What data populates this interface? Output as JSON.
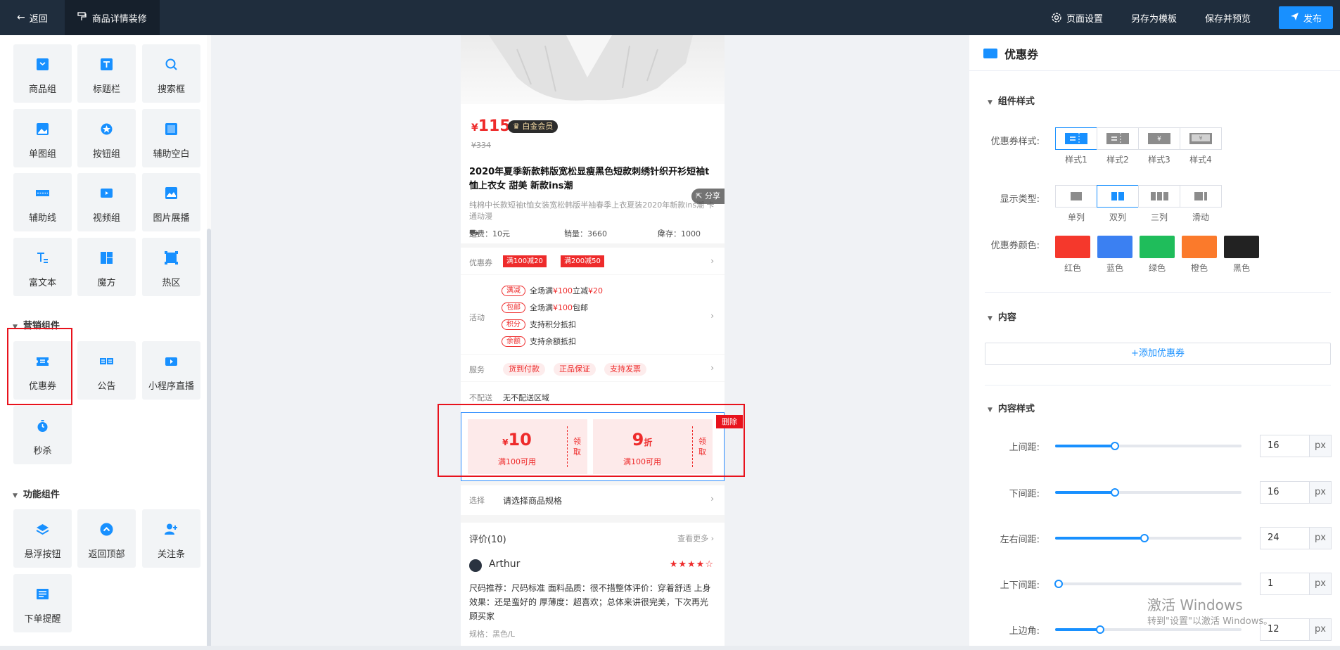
{
  "topbar": {
    "back_label": "返回",
    "active_tab": "商品详情装修",
    "page_settings": "页面设置",
    "save_template": "另存为模板",
    "save_preview": "保存并预览",
    "publish": "发布"
  },
  "left": {
    "basic_components": [
      "商品组",
      "标题栏",
      "搜索框",
      "单图组",
      "按钮组",
      "辅助空白",
      "辅助线",
      "视频组",
      "图片展播",
      "富文本",
      "魔方",
      "热区"
    ],
    "marketing_title": "营销组件",
    "marketing_components": [
      "优惠券",
      "公告",
      "小程序直播",
      "秒杀"
    ],
    "function_title": "功能组件",
    "function_components": [
      "悬浮按钮",
      "返回顶部",
      "关注条",
      "下单提醒"
    ]
  },
  "phone": {
    "price_symbol": "¥",
    "price": "115",
    "vip_badge": "白金会员",
    "old_price": "¥334",
    "title": "2020年夏季新款韩版宽松显瘦黑色短款刺绣针织开衫短袖t恤上衣女 甜美 新款ins潮",
    "desc": "纯棉中长款短袖t恤女装宽松韩版半袖春季上衣夏装2020年新款ins潮 卡通动漫",
    "share": "分享",
    "freight": "运费：10元",
    "sales": "销量：3660",
    "stock": "库存：1000",
    "coupon_label": "优惠券",
    "coupon_tags": [
      "满100减20",
      "满200减50"
    ],
    "activity_label": "活动",
    "activities": [
      {
        "badge": "满减",
        "pre": "全场满 ",
        "red1": "¥100",
        "mid": " 立减 ",
        "red2": "¥20",
        "post": ""
      },
      {
        "badge": "包邮",
        "pre": "全场满 ",
        "red1": "¥100",
        "mid": "包邮",
        "red2": "",
        "post": ""
      },
      {
        "badge": "积分",
        "pre": "支持积分抵扣",
        "red1": "",
        "mid": "",
        "red2": "",
        "post": ""
      },
      {
        "badge": "余额",
        "pre": "支持余额抵扣",
        "red1": "",
        "mid": "",
        "red2": "",
        "post": ""
      }
    ],
    "service_label": "服务",
    "services": [
      "货到付款",
      "正品保证",
      "支持发票"
    ],
    "nodelivery_label": "不配送",
    "nodelivery_value": "无不配送区域",
    "coupons": [
      {
        "prefix": "¥",
        "amount": "10",
        "suffix": "",
        "cond": "满100可用",
        "get": "领取"
      },
      {
        "prefix": "",
        "amount": "9",
        "suffix": "折",
        "cond": "满100可用",
        "get": "领取"
      }
    ],
    "delete": "删除",
    "select_label": "选择",
    "select_value": "请选择商品规格",
    "review_title": "评价(10)",
    "review_more": "查看更多",
    "reviewer": "Arthur",
    "stars": "★★★★☆",
    "review_text": "尺码推荐：尺码标准 面料品质：很不措整体评价：穿着舒适 上身效果：还是蛮好的 厚薄度：超喜欢；总体来讲很完美，下次再光顾买家",
    "review_spec": "规格：黑色/L"
  },
  "right": {
    "title": "优惠券",
    "sec_style": "组件样式",
    "style_label": "优惠券样式:",
    "styles": [
      "样式1",
      "样式2",
      "样式3",
      "样式4"
    ],
    "display_label": "显示类型:",
    "displays": [
      "单列",
      "双列",
      "三列",
      "滑动"
    ],
    "color_label": "优惠券颜色:",
    "colors": [
      {
        "name": "红色",
        "hex": "#f5382c"
      },
      {
        "name": "蓝色",
        "hex": "#3b80f2"
      },
      {
        "name": "绿色",
        "hex": "#1fbd5b"
      },
      {
        "name": "橙色",
        "hex": "#fb7a2b"
      },
      {
        "name": "黑色",
        "hex": "#222222"
      }
    ],
    "sec_content": "内容",
    "add_coupon": "+添加优惠券",
    "sec_content_style": "内容样式",
    "sliders": [
      {
        "label": "上间距:",
        "value": "16",
        "fraction": 0.32
      },
      {
        "label": "下间距:",
        "value": "16",
        "fraction": 0.32
      },
      {
        "label": "左右间距:",
        "value": "24",
        "fraction": 0.48
      },
      {
        "label": "上下间距:",
        "value": "1",
        "fraction": 0.02
      },
      {
        "label": "上边角:",
        "value": "12",
        "fraction": 0.24
      }
    ],
    "unit": "px"
  },
  "watermark": {
    "line1": "激活 Windows",
    "line2": "转到\"设置\"以激活 Windows。"
  }
}
